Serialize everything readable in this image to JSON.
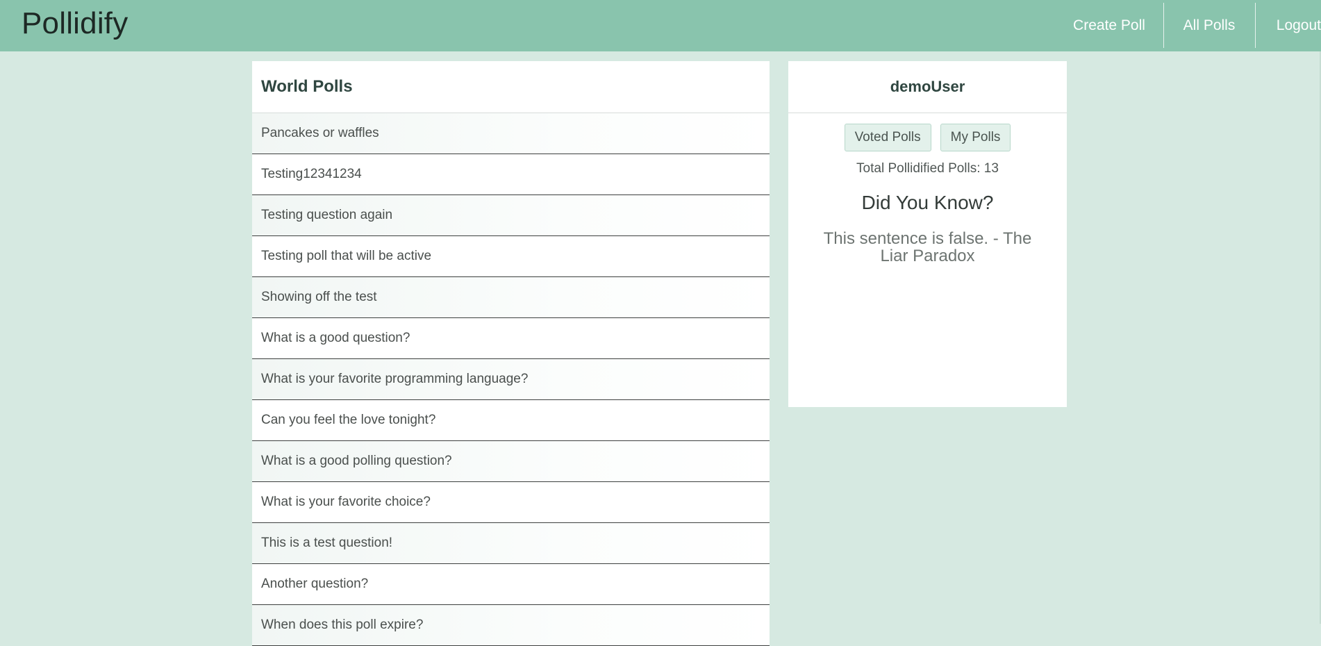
{
  "app": {
    "title": "Pollidify"
  },
  "nav": {
    "create_poll": "Create Poll",
    "all_polls": "All Polls",
    "logout": "Logout"
  },
  "world_polls": {
    "title": "World Polls",
    "items": [
      "Pancakes or waffles",
      "Testing12341234",
      "Testing question again",
      "Testing poll that will be active",
      "Showing off the test",
      "What is a good question?",
      "What is your favorite programming language?",
      "Can you feel the love tonight?",
      "What is a good polling question?",
      "What is your favorite choice?",
      "This is a test question!",
      "Another question?",
      "When does this poll expire?"
    ]
  },
  "user": {
    "name": "demoUser",
    "voted_polls": "Voted Polls",
    "my_polls": "My Polls",
    "total": "Total Pollidified Polls: 13",
    "did_you_know": "Did You Know?",
    "fact": "This sentence is false. - The Liar Paradox"
  },
  "colors": {
    "navbar": "#89c4ad",
    "background": "#d6e9e1",
    "panel": "#ffffff"
  }
}
